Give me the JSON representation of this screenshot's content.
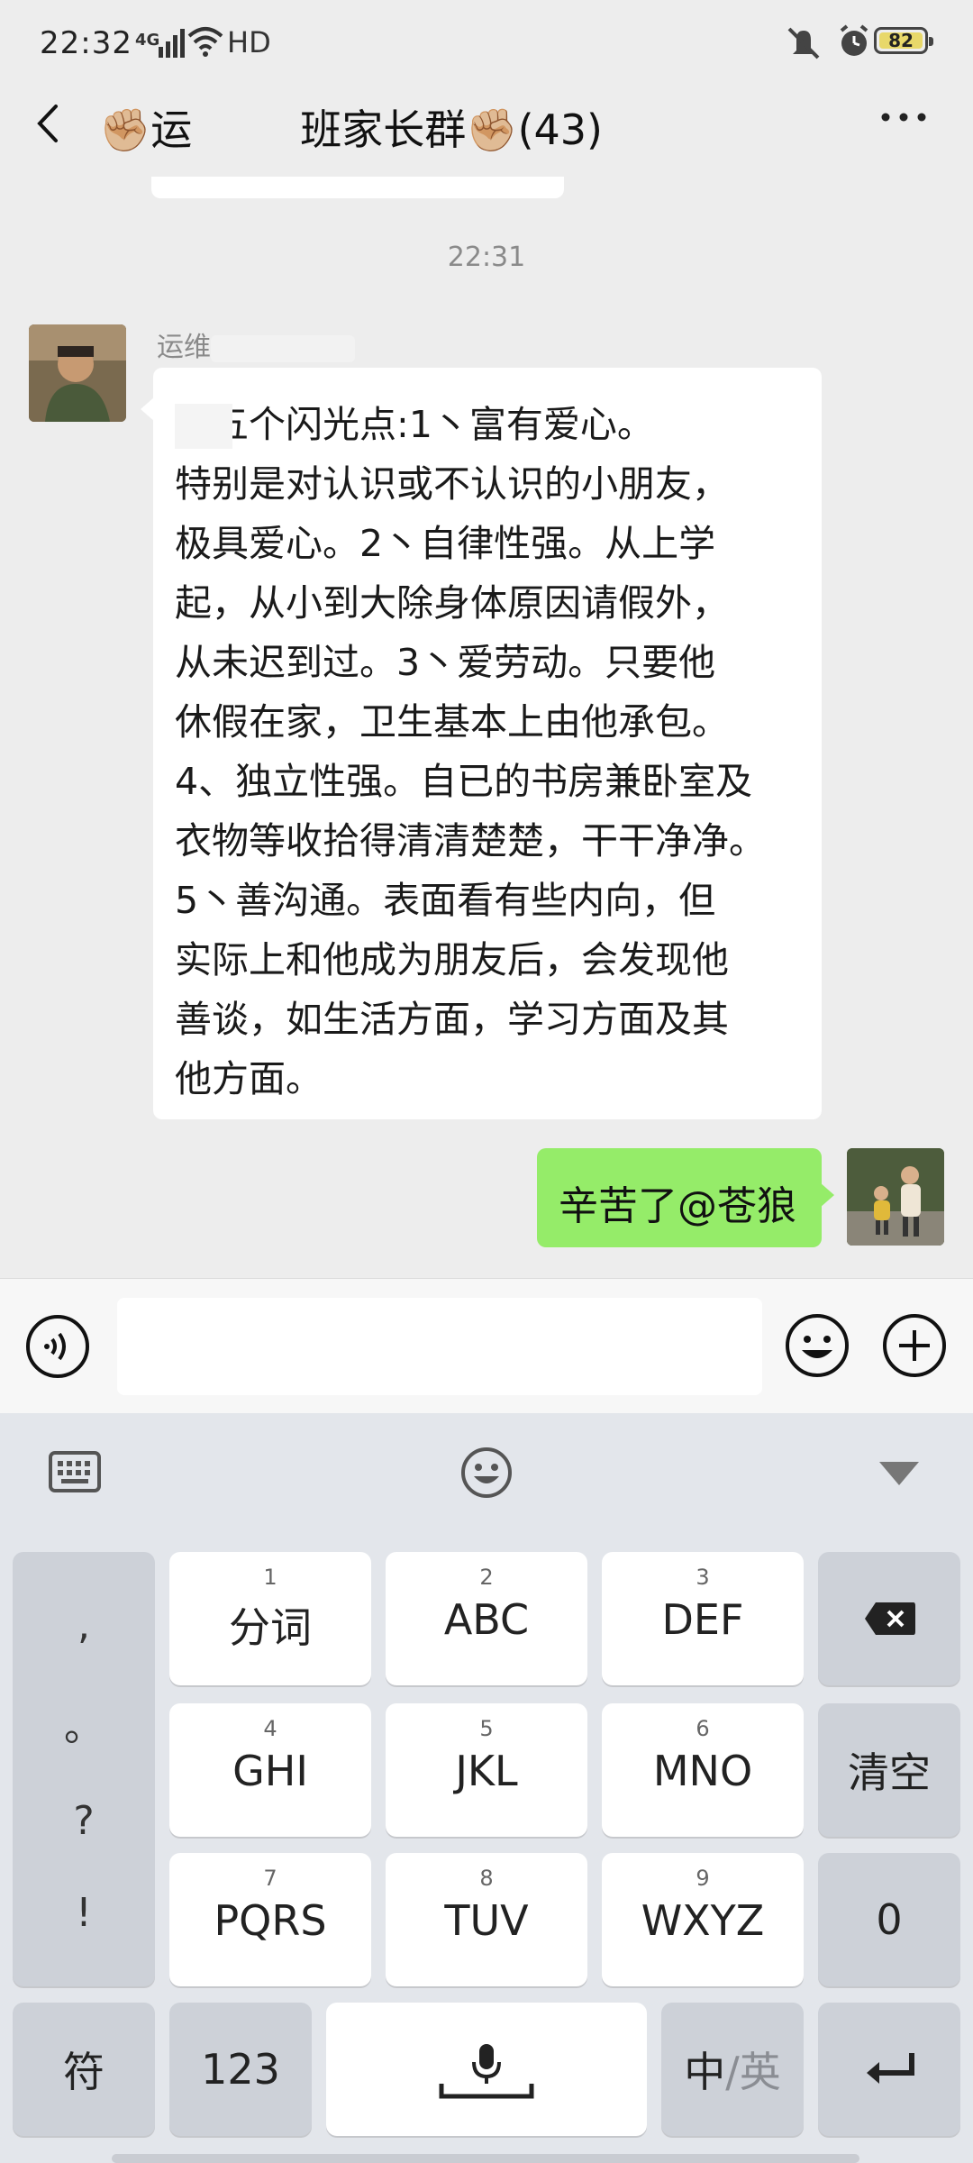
{
  "status_bar": {
    "time": "22:32",
    "network": "4G",
    "hd": "HD",
    "battery": "82"
  },
  "header": {
    "title_prefix": "✊🏼运",
    "title_suffix": "班家长群✊🏼",
    "member_count": "(43)"
  },
  "chat": {
    "timestamp": "22:31",
    "incoming": {
      "sender": "运维",
      "lines": [
        "  的五个闪光点:1丶富有爱心。",
        "特别是对认识或不认识的小朋友，",
        "极具爱心。2丶自律性强。从上学",
        "起，从小到大除身体原因请假外，",
        "从未迟到过。3丶爱劳动。只要他",
        "休假在家，卫生基本上由他承包。",
        "4、独立性强。自已的书房兼卧室及",
        "衣物等收拾得清清楚楚，干干净净。",
        "5丶善沟通。表面看有些内向，但",
        "实际上和他成为朋友后，会发现他",
        "善谈，如生活方面，学习方面及其",
        "他方面。"
      ]
    },
    "outgoing": {
      "text": "辛苦了@苍狼"
    }
  },
  "input_bar": {
    "placeholder": ""
  },
  "keyboard": {
    "punctuation": [
      ",",
      "。",
      "?",
      "!"
    ],
    "keys": [
      {
        "num": "1",
        "label": "分词"
      },
      {
        "num": "2",
        "label": "ABC"
      },
      {
        "num": "3",
        "label": "DEF"
      },
      {
        "num": "4",
        "label": "GHI"
      },
      {
        "num": "5",
        "label": "JKL"
      },
      {
        "num": "6",
        "label": "MNO"
      },
      {
        "num": "7",
        "label": "PQRS"
      },
      {
        "num": "8",
        "label": "TUV"
      },
      {
        "num": "9",
        "label": "WXYZ"
      }
    ],
    "clear": "清空",
    "zero": "0",
    "symbol": "符",
    "numeric": "123",
    "lang_main": "中",
    "lang_alt": "/英"
  }
}
